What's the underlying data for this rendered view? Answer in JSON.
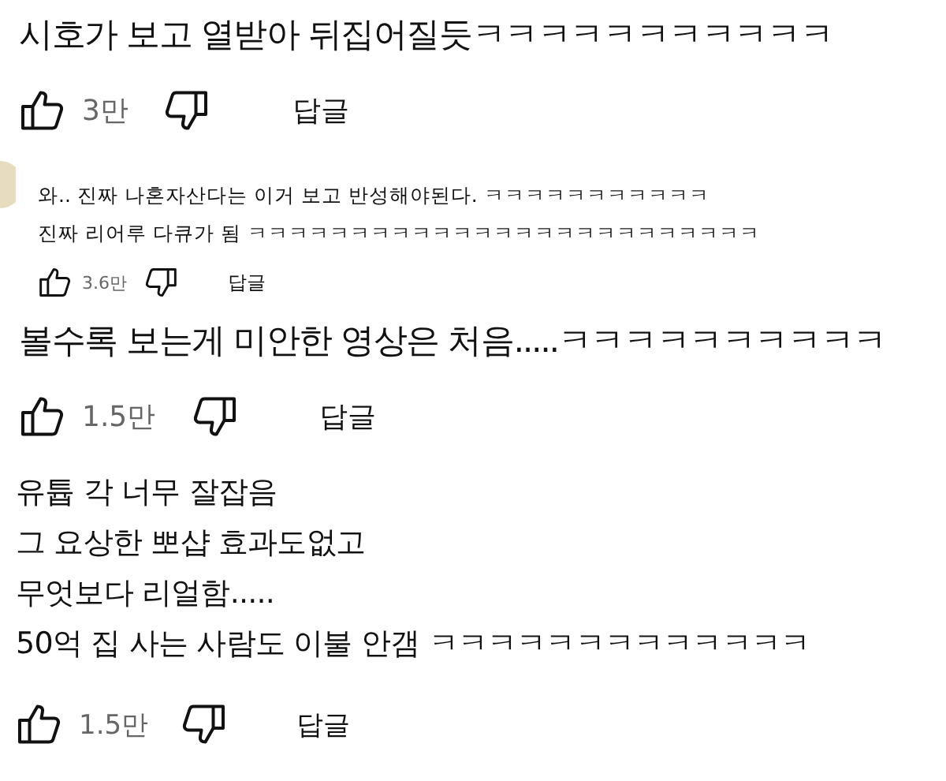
{
  "comments": [
    {
      "kind": "large",
      "lines": [
        "시호가 보고 열받아 뒤집어질듯ㅋㅋㅋㅋㅋㅋㅋㅋㅋㅋㅋ"
      ],
      "likes": "3만",
      "reply": "답글"
    },
    {
      "kind": "small",
      "lines": [
        "와.. 진짜 나혼자산다는 이거 보고 반성해야된다. ㅋㅋㅋㅋㅋㅋㅋㅋㅋㅋㅋ",
        "진짜 리어루 다큐가 됨 ㅋㅋㅋㅋㅋㅋㅋㅋㅋㅋㅋㅋㅋㅋㅋㅋㅋㅋㅋㅋㅋㅋㅋㅋㅋ"
      ],
      "likes": "3.6만",
      "reply": "답글"
    },
    {
      "kind": "large",
      "lines": [
        "볼수록 보는게 미안한 영상은 처음.....ㅋㅋㅋㅋㅋㅋㅋㅋㅋㅋ"
      ],
      "likes": "1.5만",
      "reply": "답글"
    },
    {
      "kind": "medium",
      "lines": [
        "유튭  각 너무 잘잡음",
        "그 요상한 뽀샵 효과도없고",
        "무엇보다 리얼함.....",
        "50억 집 사는 사람도 이불 안갬 ㅋㅋㅋㅋㅋㅋㅋㅋㅋㅋㅋㅋㅋ"
      ],
      "likes": "1.5만",
      "reply": "답글"
    }
  ]
}
